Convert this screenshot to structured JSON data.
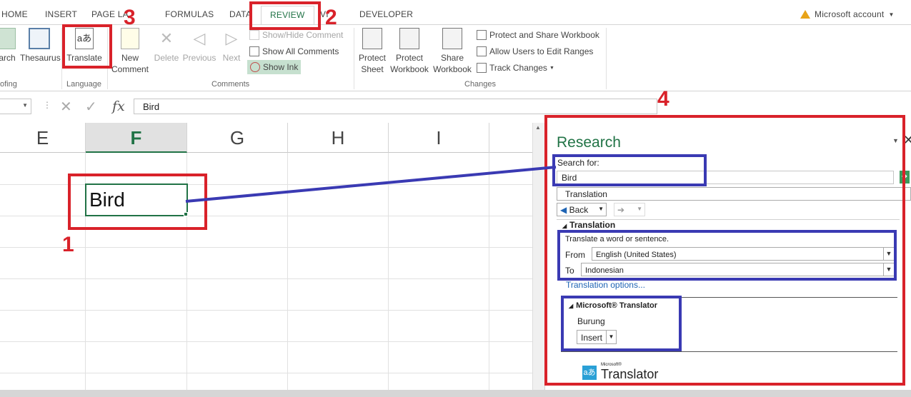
{
  "ribbon_tabs": [
    "HOME",
    "INSERT",
    "PAGE LA",
    "FORMULAS",
    "DATA",
    "REVIEW",
    "VI",
    "DEVELOPER"
  ],
  "active_tab": "REVIEW",
  "account": "Microsoft account",
  "proofing": {
    "search_label": "arch",
    "thesaurus": "Thesaurus",
    "group": "ofing"
  },
  "language": {
    "translate": "Translate",
    "group": "Language"
  },
  "comments": {
    "new": "New",
    "new2": "Comment",
    "delete": "Delete",
    "previous": "Previous",
    "next": "Next",
    "show_hide": "Show/Hide Comment",
    "show_all": "Show All Comments",
    "show_ink": "Show Ink",
    "group": "Comments"
  },
  "changes": {
    "protect_sheet_1": "Protect",
    "protect_sheet_2": "Sheet",
    "protect_wb_1": "Protect",
    "protect_wb_2": "Workbook",
    "share_wb_1": "Share",
    "share_wb_2": "Workbook",
    "protect_share": "Protect and Share Workbook",
    "allow_users": "Allow Users to Edit Ranges",
    "track_changes": "Track Changes",
    "group": "Changes"
  },
  "formula_bar": {
    "fx": "fx",
    "value": "Bird"
  },
  "columns": [
    "E",
    "F",
    "G",
    "H",
    "I"
  ],
  "active_cell_value": "Bird",
  "research": {
    "title": "Research",
    "search_for_label": "Search for:",
    "search_value": "Bird",
    "service": "Translation",
    "back": "Back",
    "section": "Translation",
    "intro": "Translate a word or sentence.",
    "from_label": "From",
    "from_value": "English (United States)",
    "to_label": "To",
    "to_value": "Indonesian",
    "options_link": "Translation options...",
    "provider": "Microsoft® Translator",
    "result": "Burung",
    "insert": "Insert",
    "logo_small": "Microsoft®",
    "logo": "Translator"
  },
  "annotations": {
    "n1": "1",
    "n2": "2",
    "n3": "3",
    "n4": "4"
  },
  "colors": {
    "excel_green": "#217346",
    "annotation_red": "#d9222a",
    "annotation_blue": "#3a3ab3"
  }
}
